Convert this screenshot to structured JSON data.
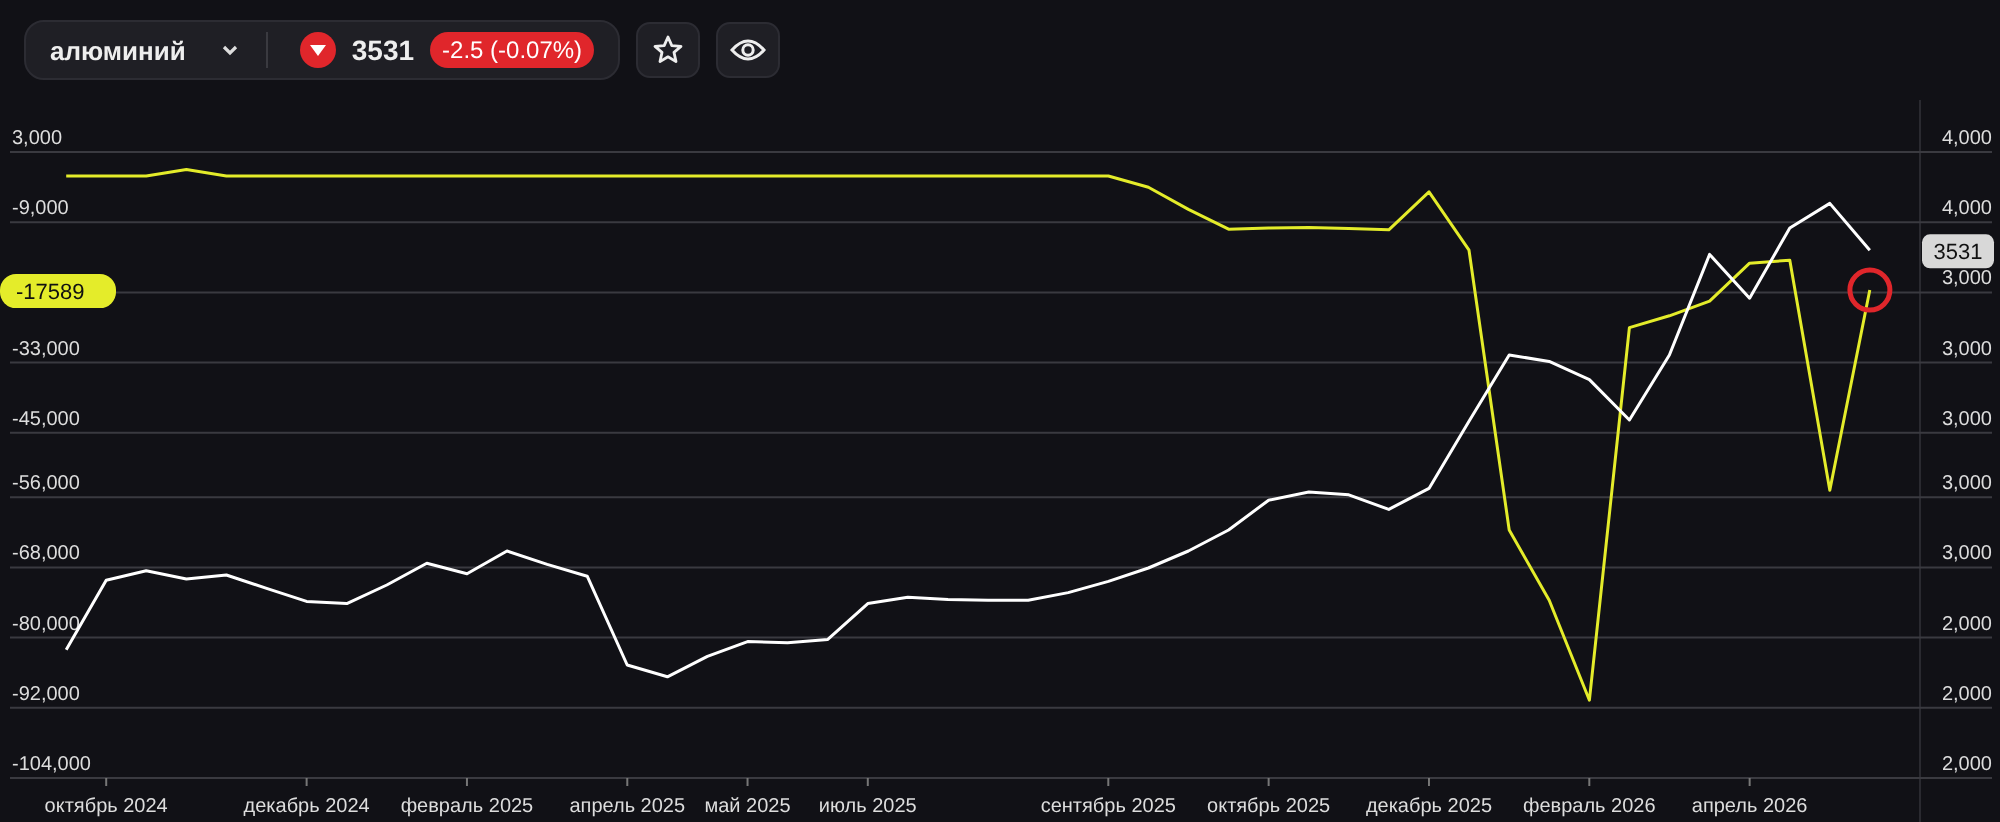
{
  "toolbar": {
    "instrument": "алюминий",
    "falling": true,
    "price": "3531",
    "change": "-2.5 (-0.07%)"
  },
  "chart": {
    "index_value": "-17589",
    "price_value": "3531",
    "right_axis_labels": [
      "4,000",
      "4,000",
      "3,000",
      "3,000",
      "3,000",
      "3,000",
      "3,000",
      "2,000",
      "2,000",
      "2,000"
    ],
    "chart_data": {
      "type": "line",
      "grid": true,
      "ylim": [
        -104000,
        3000
      ],
      "categories": [
        null,
        "октябрь 2024",
        null,
        null,
        null,
        null,
        "декабрь 2024",
        null,
        null,
        null,
        "февраль 2025",
        null,
        null,
        null,
        "апрель 2025",
        null,
        null,
        "май 2025",
        null,
        null,
        "июль 2025",
        null,
        null,
        null,
        null,
        null,
        "сентябрь 2025",
        null,
        null,
        null,
        "октябрь 2025",
        null,
        null,
        null,
        "декабрь 2025",
        null,
        null,
        null,
        "февраль 2026",
        null,
        null,
        null,
        "апрель 2026",
        null,
        null,
        null
      ],
      "yticks": [
        {
          "value": 3000,
          "label": "3,000"
        },
        {
          "value": -9000,
          "label": "-9,000"
        },
        {
          "value": -33000,
          "label": "-33,000"
        },
        {
          "value": -45000,
          "label": "-45,000"
        },
        {
          "value": -56000,
          "label": "-56,000"
        },
        {
          "value": -68000,
          "label": "-68,000"
        },
        {
          "value": -80000,
          "label": "-80,000"
        },
        {
          "value": -92000,
          "label": "-92,000"
        },
        {
          "value": -104000,
          "label": "-104,000"
        }
      ],
      "series": [
        {
          "color": "#e4ec2a",
          "values": [
            -1100,
            -1100,
            -1100,
            0,
            -1100,
            -1100,
            -1100,
            -1100,
            -1100,
            -1100,
            -1100,
            -1100,
            -1100,
            -1100,
            -1100,
            -1100,
            -1100,
            -1100,
            -1100,
            -1100,
            -1100,
            -1100,
            -1100,
            -1100,
            -1100,
            -1100,
            -1100,
            -3000,
            -6800,
            -10200,
            -10000,
            -9900,
            -10100,
            -10300,
            -3800,
            -13800,
            -61600,
            -73600,
            -90700,
            -27000,
            -25000,
            -22500,
            -16000,
            -15500,
            -54800,
            -20600
          ]
        },
        {
          "color": "#ffffff",
          "values": [
            -82100,
            -70200,
            -68600,
            -70000,
            -69300,
            -71600,
            -73800,
            -74200,
            -71000,
            -67300,
            -69100,
            -65200,
            -67500,
            -69500,
            -84700,
            -86700,
            -83200,
            -80700,
            -80900,
            -80300,
            -74200,
            -73100,
            -73500,
            -73600,
            -73600,
            -72300,
            -70400,
            -68100,
            -65200,
            -61600,
            -56500,
            -55100,
            -55600,
            -58100,
            -54500,
            -43000,
            -31700,
            -32800,
            -35900,
            -42800,
            -31700,
            -14500,
            -22000,
            -10000,
            -5800,
            -13800
          ]
        }
      ]
    }
  }
}
